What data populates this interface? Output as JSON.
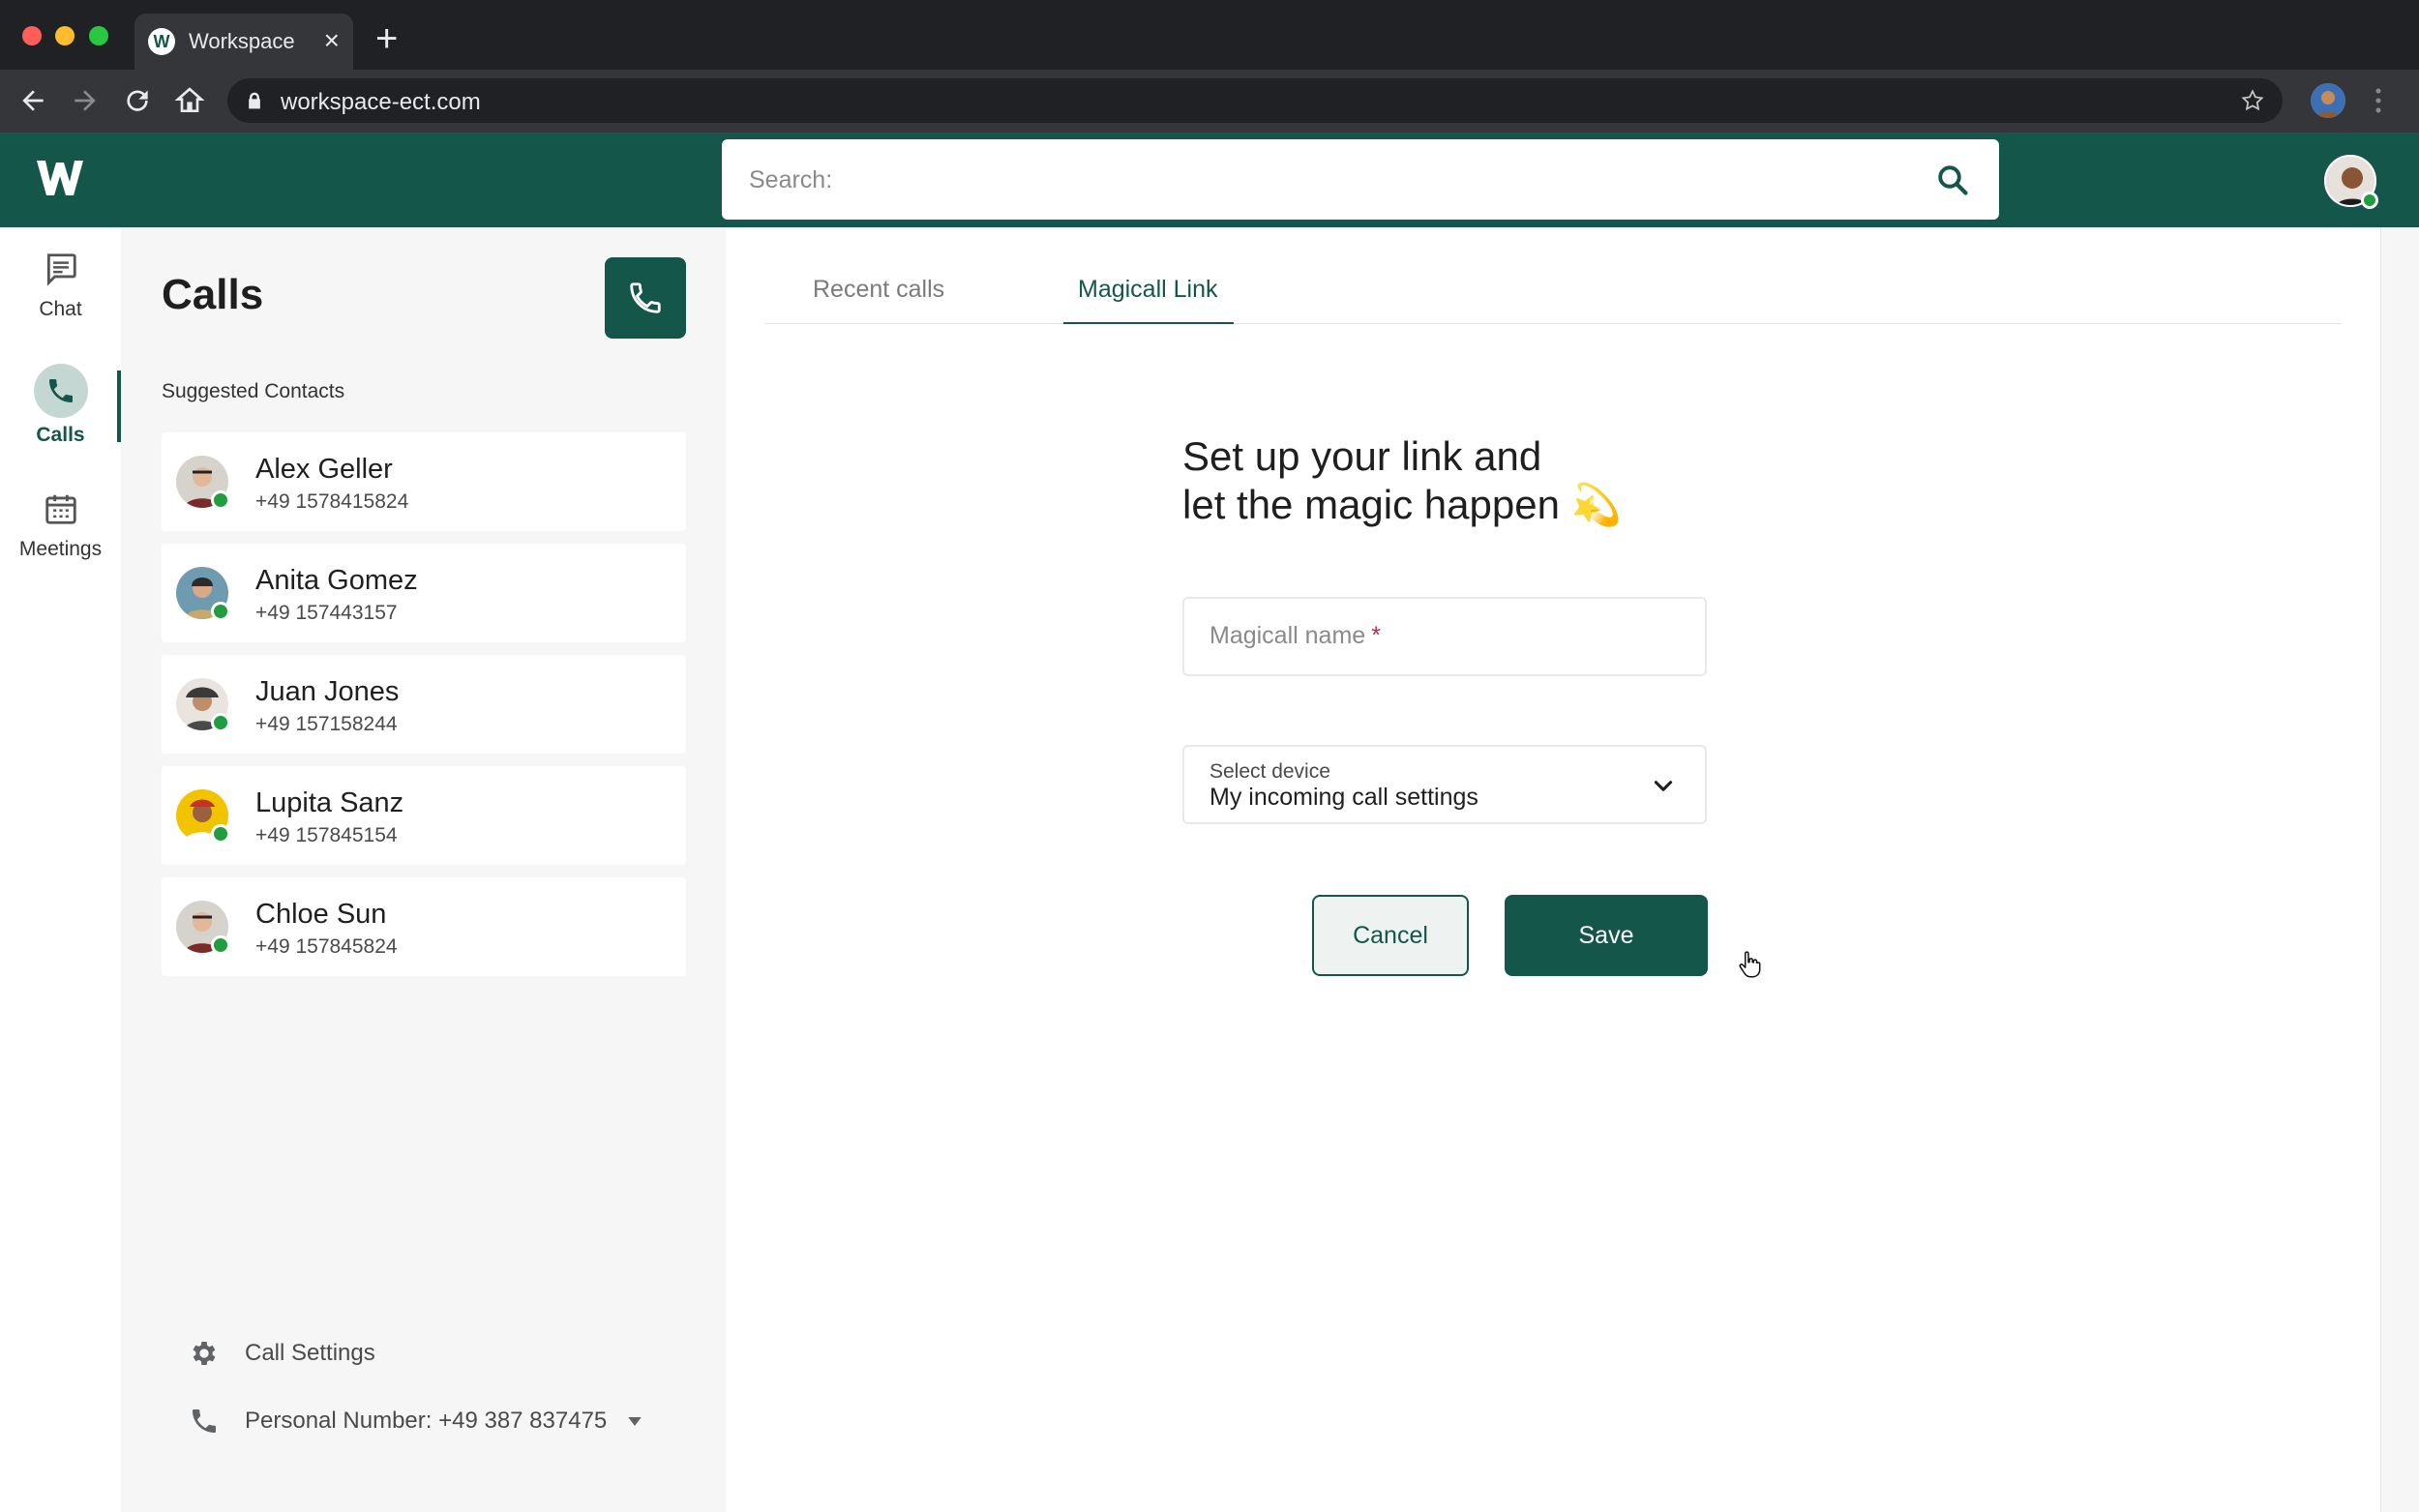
{
  "browser": {
    "tab_title": "Workspace",
    "tab_favicon_letter": "W",
    "url": "workspace-ect.com",
    "new_tab_glyph": "+",
    "close_glyph": "×"
  },
  "header": {
    "search_placeholder": "Search:",
    "logo_letter": "w",
    "brand_color": "#14574a"
  },
  "rail": {
    "items": [
      {
        "label": "Chat",
        "icon": "chat-icon"
      },
      {
        "label": "Calls",
        "icon": "phone-icon",
        "active": true
      },
      {
        "label": "Meetings",
        "icon": "calendar-icon"
      }
    ]
  },
  "calls_panel": {
    "title": "Calls",
    "suggested_heading": "Suggested Contacts",
    "contacts": [
      {
        "name": "Alex Geller",
        "phone": "+49 1578415824",
        "status": "online"
      },
      {
        "name": "Anita Gomez",
        "phone": "+49 157443157",
        "status": "online"
      },
      {
        "name": "Juan Jones",
        "phone": "+49 157158244",
        "status": "online"
      },
      {
        "name": "Lupita Sanz",
        "phone": "+49 157845154",
        "status": "online"
      },
      {
        "name": "Chloe Sun",
        "phone": "+49 157845824",
        "status": "online"
      }
    ],
    "call_settings_label": "Call Settings",
    "personal_number_label": "Personal Number: +49 387 837475"
  },
  "main": {
    "tabs": [
      {
        "label": "Recent calls",
        "active": false
      },
      {
        "label": "Magicall Link",
        "active": true
      }
    ],
    "heading_line1": "Set up your link and",
    "heading_line2": "let the magic happen",
    "heading_emoji": "💫",
    "name_field_label": "Magicall name",
    "name_field_required": "*",
    "select_label": "Select device",
    "select_value": "My incoming call settings",
    "cancel_label": "Cancel",
    "save_label": "Save"
  }
}
